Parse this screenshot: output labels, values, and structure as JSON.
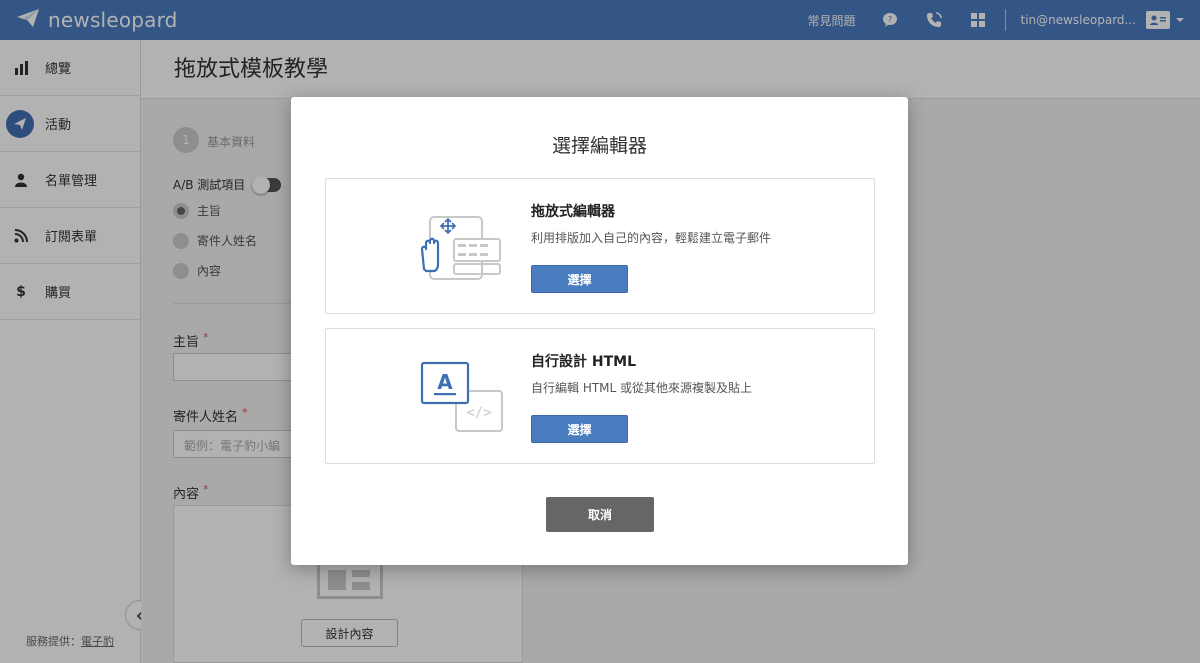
{
  "brand": {
    "name": "newsleopard"
  },
  "topbar": {
    "faq_label": "常見問題",
    "user_email": "tin@newsleopard...",
    "icons": [
      "help-bubble-icon",
      "phone-icon",
      "grid-icon",
      "user-card-icon",
      "caret-down-icon"
    ]
  },
  "sidebar": {
    "items": [
      {
        "label": "總覽",
        "icon": "bar-chart-icon",
        "active": false
      },
      {
        "label": "活動",
        "icon": "paper-plane-icon",
        "active": true
      },
      {
        "label": "名單管理",
        "icon": "person-icon",
        "active": false
      },
      {
        "label": "訂閱表單",
        "icon": "rss-icon",
        "active": false
      },
      {
        "label": "購買",
        "icon": "dollar-icon",
        "active": false
      }
    ],
    "footer_prefix": "服務提供：",
    "footer_link": "電子豹"
  },
  "page": {
    "title": "拖放式模板教學",
    "step_number": "1",
    "step_label": "基本資料",
    "ab_label": "A/B 測試項目",
    "radios": [
      {
        "label": "主旨",
        "checked": true
      },
      {
        "label": "寄件人姓名",
        "checked": false
      },
      {
        "label": "內容",
        "checked": false
      }
    ],
    "subject_label": "主旨",
    "sender_label": "寄件人姓名",
    "sender_placeholder": "範例：電子豹小編",
    "content_label": "內容",
    "required_mark": "*",
    "design_button": "設計內容"
  },
  "modal": {
    "title": "選擇編輯器",
    "options": [
      {
        "title": "拖放式編輯器",
        "description": "利用排版加入自己的內容，輕鬆建立電子郵件",
        "button": "選擇",
        "icon": "drag-drop-editor-icon"
      },
      {
        "title": "自行設計 HTML",
        "description": "自行編輯 HTML 或從其他來源複製及貼上",
        "button": "選擇",
        "icon": "html-code-editor-icon"
      }
    ],
    "cancel": "取消"
  },
  "colors": {
    "brand_blue": "#4a7cc0",
    "cancel_gray": "#666666",
    "overlay": "rgba(0,0,0,0.3)"
  }
}
